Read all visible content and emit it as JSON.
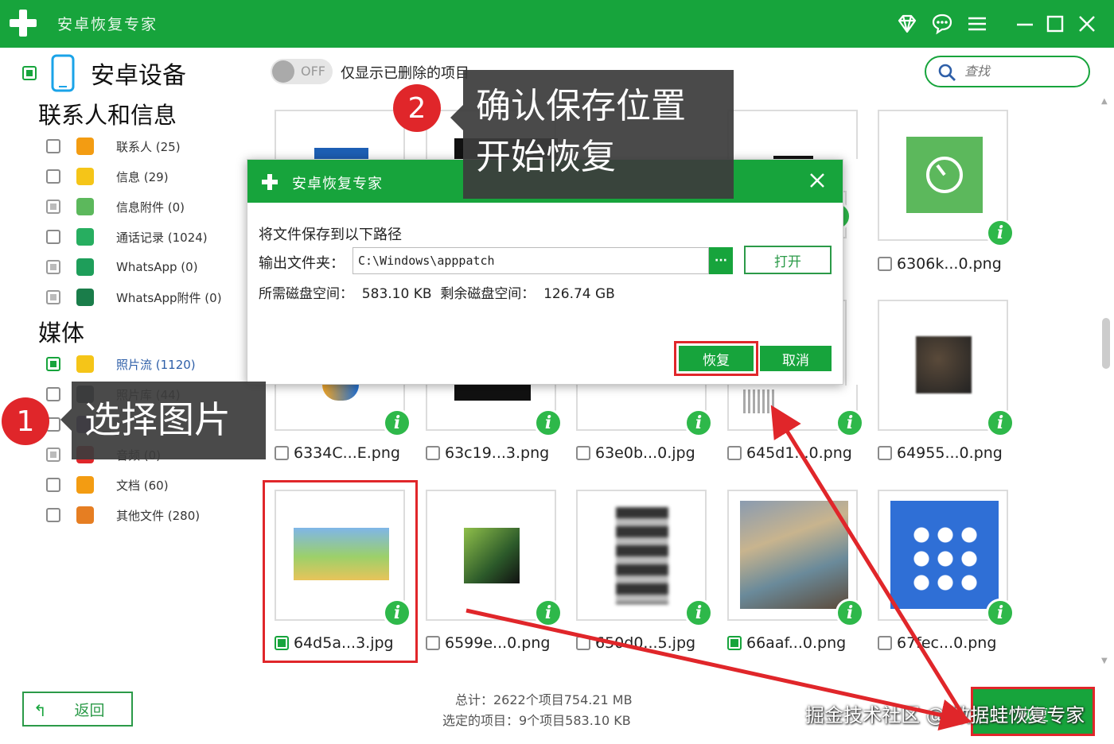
{
  "window": {
    "title": "安卓恢复专家"
  },
  "titlebar_icons": [
    "diamond-icon",
    "chat-icon",
    "menu-icon",
    "minimize-icon",
    "maximize-icon",
    "close-icon"
  ],
  "sidebar": {
    "device": "安卓设备",
    "section_contacts": "联系人和信息",
    "contacts_items": [
      {
        "label": "联系人 (25)",
        "icon": "contacts-icon",
        "color": "#f39c12",
        "state": "unchecked"
      },
      {
        "label": "信息 (29)",
        "icon": "messages-icon",
        "color": "#f5c518",
        "state": "unchecked"
      },
      {
        "label": "信息附件 (0)",
        "icon": "attachment-icon",
        "color": "#5cb85c",
        "state": "partial"
      },
      {
        "label": "通话记录 (1024)",
        "icon": "call-log-icon",
        "color": "#27ae60",
        "state": "unchecked"
      },
      {
        "label": "WhatsApp (0)",
        "icon": "whatsapp-icon",
        "color": "#1e9e5a",
        "state": "partial"
      },
      {
        "label": "WhatsApp附件 (0)",
        "icon": "whatsapp-attachment-icon",
        "color": "#1a7d4a",
        "state": "partial"
      }
    ],
    "section_media": "媒体",
    "media_items": [
      {
        "label": "照片流 (1120)",
        "icon": "photo-stream-icon",
        "color": "#f5c518",
        "state": "checked",
        "active": true
      },
      {
        "label": "照片库 (44)",
        "icon": "photo-library-icon",
        "color": "#2c3e50",
        "state": "unchecked"
      },
      {
        "label": "",
        "icon": "video-icon",
        "color": "#6a4fa0",
        "state": "unchecked"
      },
      {
        "label": "音频 (0)",
        "icon": "audio-icon",
        "color": "#e0262a",
        "state": "partial"
      },
      {
        "label": "文档 (60)",
        "icon": "documents-icon",
        "color": "#f39c12",
        "state": "unchecked"
      },
      {
        "label": "其他文件 (280)",
        "icon": "other-files-icon",
        "color": "#e67e22",
        "state": "unchecked"
      }
    ]
  },
  "toolbar": {
    "toggle_text": "OFF",
    "toggle_label": "仅显示已删除的项目",
    "search_placeholder": "查找"
  },
  "grid": {
    "row2": [
      {
        "name": "6334C...E.png",
        "checked": false
      },
      {
        "name": "63c19...3.png",
        "checked": false
      },
      {
        "name": "63e0b...0.jpg",
        "checked": false
      },
      {
        "name": "645d1...0.png",
        "checked": false
      },
      {
        "name": "64955...0.png",
        "checked": false
      }
    ],
    "row3": [
      {
        "name": "64d5a...3.jpg",
        "checked": true
      },
      {
        "name": "6599e...0.png",
        "checked": false
      },
      {
        "name": "650d0...5.jpg",
        "checked": false
      },
      {
        "name": "66aaf...0.png",
        "checked": true
      },
      {
        "name": "67fec...0.png",
        "checked": false
      }
    ],
    "row1_last": {
      "name": "6306k...0.png",
      "checked": false
    }
  },
  "footer": {
    "back_label": "返回",
    "total": "总计：2622个项目754.21 MB",
    "selected": "选定的项目：9个项目583.10 KB",
    "recover_label": "恢复",
    "watermark": "掘金技术社区 @ 数据蛙恢复专家"
  },
  "dialog": {
    "title": "安卓恢复专家",
    "prompt": "将文件保存到以下路径",
    "output_label": "输出文件夹：",
    "path": "C:\\Windows\\apppatch",
    "browse_label": "···",
    "open_label": "打开",
    "space_line": "所需磁盘空间：  583.10 KB  剩余磁盘空间：  126.74 GB",
    "ok_label": "恢复",
    "cancel_label": "取消"
  },
  "callouts": {
    "step1_num": "1",
    "step1_text": "选择图片",
    "step2_num": "2",
    "step2_line1": "确认保存位置",
    "step2_line2": "开始恢复"
  },
  "colors": {
    "brand_green": "#17a43c",
    "highlight_red": "#e0262a",
    "callout_bg": "#3c3c3c"
  }
}
